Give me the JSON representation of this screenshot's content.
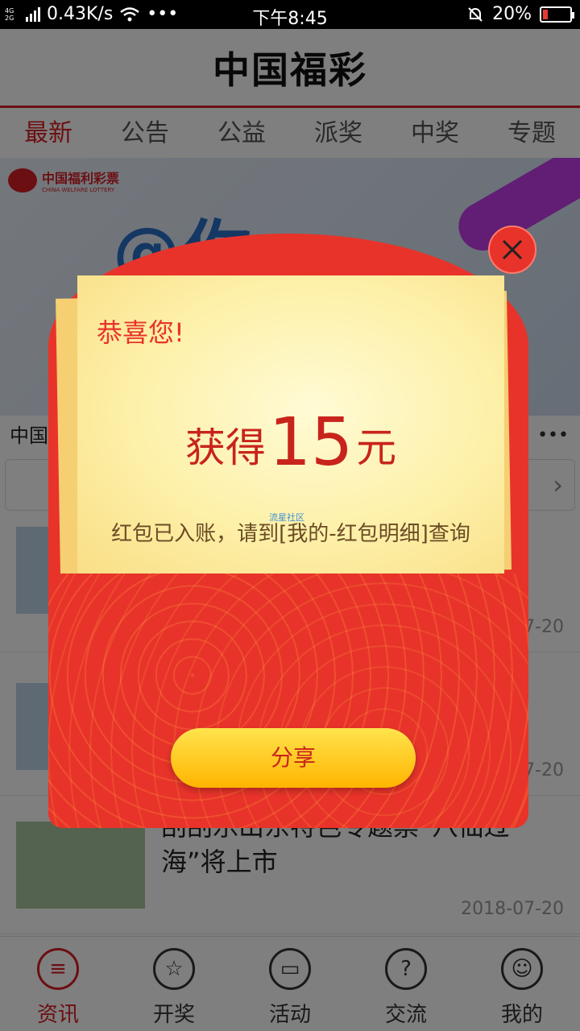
{
  "status_bar": {
    "network_top": "4G",
    "network_bottom": "2G",
    "speed": "0.43K/s",
    "time": "下午8:45",
    "battery": "20%",
    "battery_level": 0.2,
    "more": "•••"
  },
  "header": {
    "title": "中国福彩"
  },
  "tabs": [
    {
      "label": "最新",
      "active": true
    },
    {
      "label": "公告",
      "active": false
    },
    {
      "label": "公益",
      "active": false
    },
    {
      "label": "派奖",
      "active": false
    },
    {
      "label": "中奖",
      "active": false
    },
    {
      "label": "专题",
      "active": false
    }
  ],
  "banner": {
    "logo_text": "中国福利彩票",
    "logo_sub": "CHINA WELFARE LOTTERY",
    "text": "@你"
  },
  "notice": {
    "text": "中国",
    "dots": "•••"
  },
  "news": [
    {
      "title": "",
      "date": "7-20"
    },
    {
      "title": "",
      "date": "7-20"
    },
    {
      "title": "刮刮乐山东特色专题票“八仙过海”将上市",
      "date": "2018-07-20"
    }
  ],
  "bottom_nav": [
    {
      "label": "资讯",
      "icon": "list-icon",
      "active": true
    },
    {
      "label": "开奖",
      "icon": "star-icon",
      "active": false
    },
    {
      "label": "活动",
      "icon": "tv-icon",
      "active": false
    },
    {
      "label": "交流",
      "icon": "question-icon",
      "active": false
    },
    {
      "label": "我的",
      "icon": "user-icon",
      "active": false
    }
  ],
  "popup": {
    "congrats": "恭喜您!",
    "prefix": "获得",
    "amount": "15",
    "unit": "元",
    "note": "红包已入账，请到[我的-红包明细]查询",
    "watermark": "流星社区",
    "share_label": "分享",
    "close_icon": "close-icon"
  },
  "colors": {
    "brand": "#d81e25",
    "envelope": "#e8332a",
    "button": "#ffc400"
  }
}
